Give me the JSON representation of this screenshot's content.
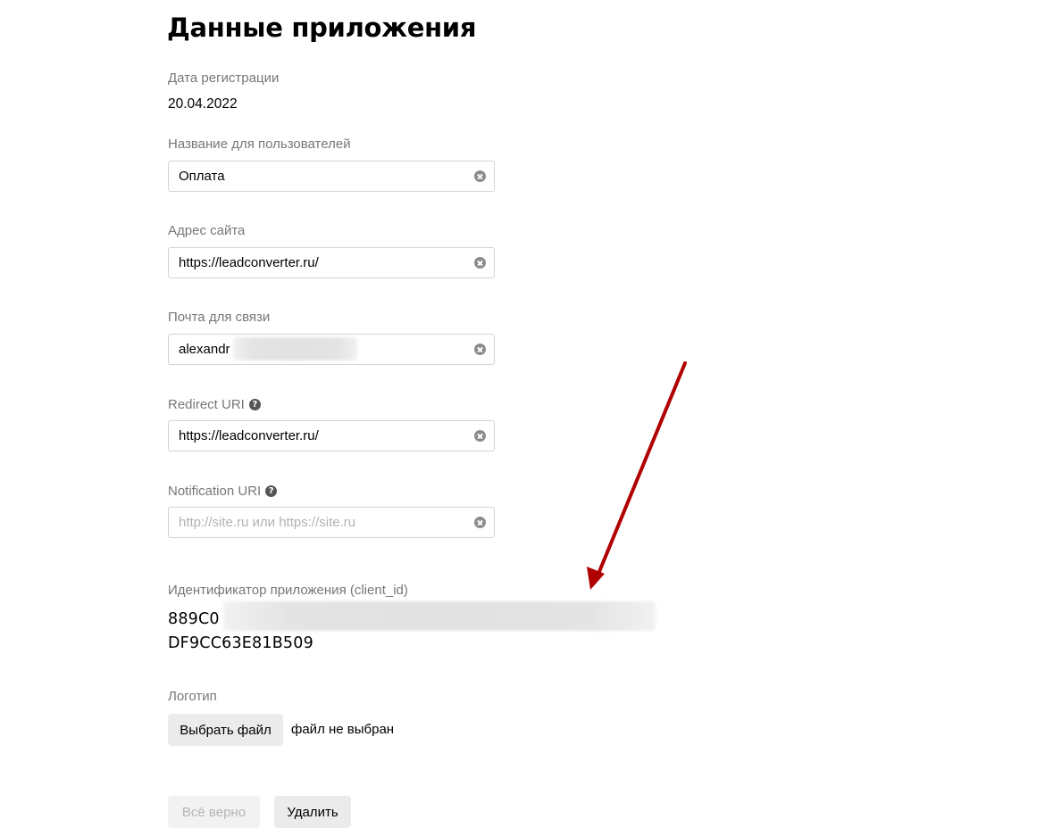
{
  "page": {
    "title": "Данные приложения"
  },
  "registration": {
    "label": "Дата регистрации",
    "value": "20.04.2022"
  },
  "fields": {
    "user_name": {
      "label": "Название для пользователей",
      "value": "Оплата",
      "placeholder": ""
    },
    "site_address": {
      "label": "Адрес сайта",
      "value": "https://leadconverter.ru/",
      "placeholder": ""
    },
    "contact_email": {
      "label": "Почта для связи",
      "value": "alexandr",
      "placeholder": ""
    },
    "redirect_uri": {
      "label": "Redirect URI",
      "value": "https://leadconverter.ru/",
      "placeholder": ""
    },
    "notification_uri": {
      "label": "Notification URI",
      "value": "",
      "placeholder": "http://site.ru или https://site.ru"
    }
  },
  "client_id": {
    "label": "Идентификатор приложения (client_id)",
    "line1_visible": "889C0",
    "line2": "DF9CC63E81B509"
  },
  "logo": {
    "label": "Логотип",
    "choose_button": "Выбрать файл",
    "file_status": "файл не выбран"
  },
  "actions": {
    "confirm_button": "Всё верно",
    "delete_button": "Удалить"
  },
  "icons": {
    "help": "question-circle-icon",
    "clear": "clear-x-circle-icon"
  },
  "annotation": {
    "arrow_color": "#b00000"
  }
}
